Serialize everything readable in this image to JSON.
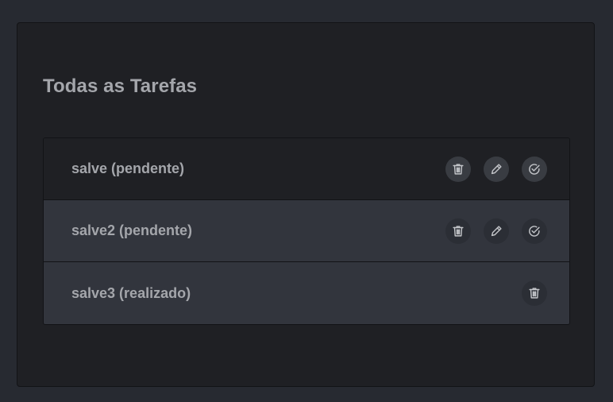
{
  "page": {
    "title": "Todas as Tarefas"
  },
  "tasks": [
    {
      "label": "salve (pendente)",
      "actions": [
        "trash-icon",
        "pencil-icon",
        "check-circle-icon"
      ]
    },
    {
      "label": "salve2 (pendente)",
      "actions": [
        "trash-icon",
        "pencil-icon",
        "check-circle-icon"
      ]
    },
    {
      "label": "salve3 (realizado)",
      "actions": [
        "trash-icon"
      ]
    }
  ],
  "colors": {
    "background": "#272a31",
    "card": "#1f2024",
    "row_alt": "#32353d",
    "text": "#a4a6ab",
    "icon_button": "#393c42"
  }
}
